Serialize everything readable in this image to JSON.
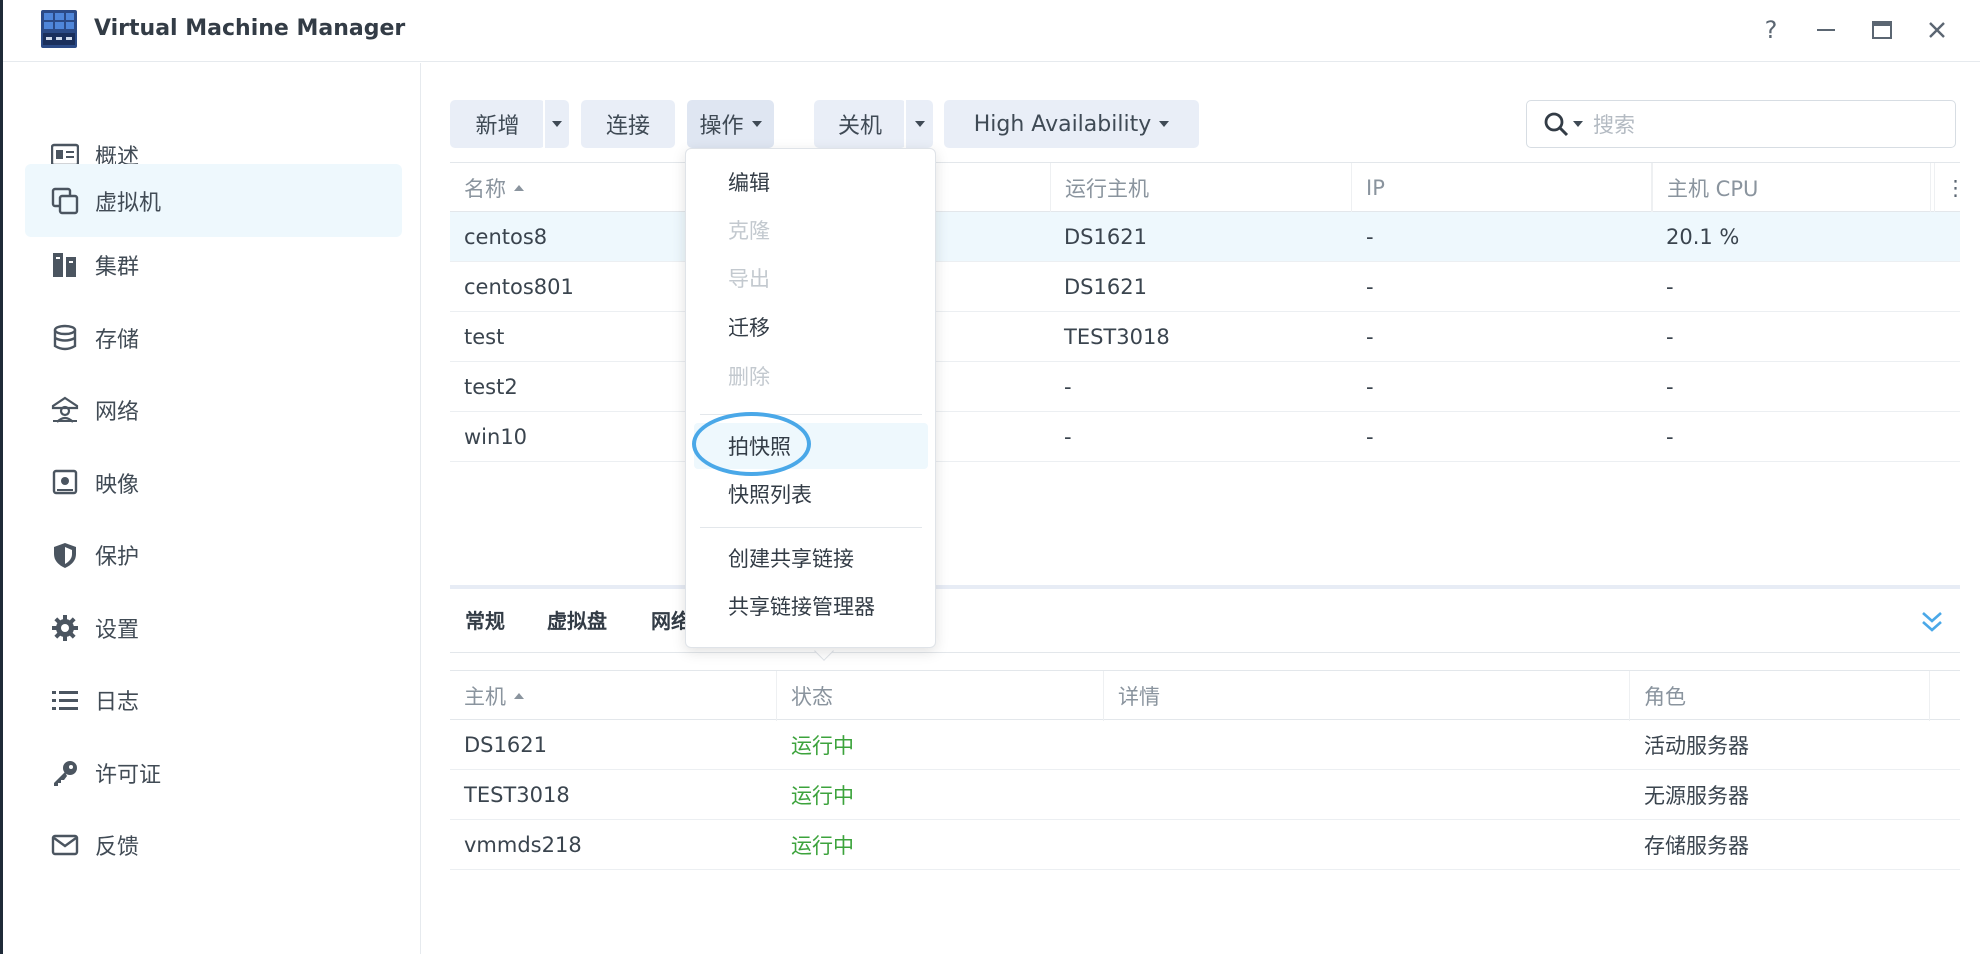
{
  "window": {
    "title": "Virtual Machine Manager",
    "controls": {
      "help": "?",
      "minimize": "—",
      "maximize": "□",
      "close": "✕"
    }
  },
  "sidebar": {
    "items": [
      {
        "label": "概述",
        "icon": "overview-icon"
      },
      {
        "label": "虚拟机",
        "icon": "virtual-machine-icon",
        "active": true
      },
      {
        "label": "集群",
        "icon": "cluster-icon"
      },
      {
        "label": "存储",
        "icon": "storage-icon"
      },
      {
        "label": "网络",
        "icon": "network-icon"
      },
      {
        "label": "映像",
        "icon": "image-icon"
      },
      {
        "label": "保护",
        "icon": "shield-icon"
      },
      {
        "label": "设置",
        "icon": "gear-icon"
      },
      {
        "label": "日志",
        "icon": "log-list-icon"
      },
      {
        "label": "许可证",
        "icon": "key-icon"
      },
      {
        "label": "反馈",
        "icon": "mail-icon"
      }
    ]
  },
  "toolbar": {
    "new": "新增",
    "connect": "连接",
    "action": "操作",
    "shutdown": "关机",
    "ha": "High Availability",
    "search_placeholder": "搜索"
  },
  "vm_table": {
    "columns": [
      "名称",
      "运行主机",
      "IP",
      "主机 CPU"
    ],
    "rows": [
      {
        "name": "centos8",
        "host": "DS1621",
        "ip": "-",
        "cpu": "20.1 %"
      },
      {
        "name": "centos801",
        "host": "DS1621",
        "ip": "-",
        "cpu": "-"
      },
      {
        "name": "test",
        "host": "TEST3018",
        "ip": "-",
        "cpu": "-"
      },
      {
        "name": "test2",
        "host": "-",
        "ip": "-",
        "cpu": "-"
      },
      {
        "name": "win10",
        "host": "-",
        "ip": "-",
        "cpu": "-"
      }
    ]
  },
  "detail": {
    "tabs": [
      "常规",
      "虚拟盘",
      "网络"
    ],
    "columns": [
      "主机",
      "状态",
      "详情",
      "角色"
    ],
    "rows": [
      {
        "host": "DS1621",
        "status": "运行中",
        "detail": "",
        "role": "活动服务器"
      },
      {
        "host": "TEST3018",
        "status": "运行中",
        "detail": "",
        "role": "无源服务器"
      },
      {
        "host": "vmmds218",
        "status": "运行中",
        "detail": "",
        "role": "存储服务器"
      }
    ]
  },
  "action_menu": {
    "items": {
      "edit": "编辑",
      "clone": "克隆",
      "export": "导出",
      "migrate": "迁移",
      "delete": "删除",
      "snapshot": "拍快照",
      "snapshot_list": "快照列表",
      "create_share_link": "创建共享链接",
      "share_link_manager": "共享链接管理器"
    }
  },
  "colors": {
    "accent": "#4aa8e8",
    "running": "#3ca33c",
    "selected_row": "#eef8fd",
    "button_bg": "#e9eef7"
  }
}
